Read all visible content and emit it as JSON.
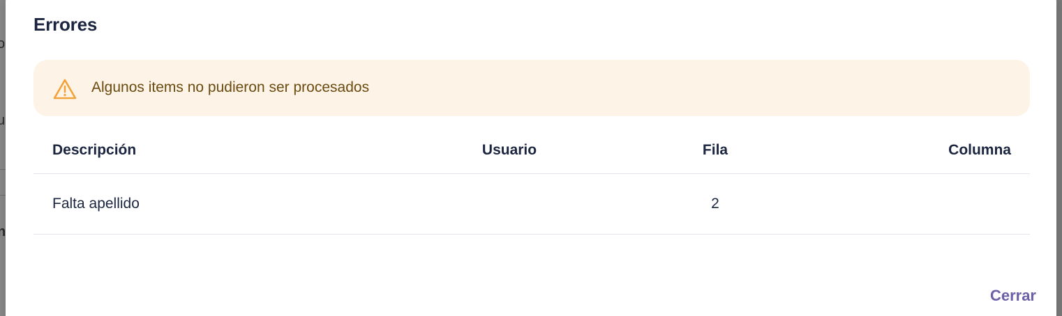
{
  "background": {
    "glyphs": [
      "o",
      "u",
      "n"
    ]
  },
  "modal": {
    "title": "Errores",
    "alert": {
      "icon": "warning-triangle-icon",
      "text": "Algunos items no pudieron ser procesados",
      "background_color": "#fdf4e7",
      "icon_color": "#f0a33a"
    },
    "table": {
      "headers": {
        "description": "Descripción",
        "user": "Usuario",
        "row": "Fila",
        "column": "Columna"
      },
      "rows": [
        {
          "description": "Falta apellido",
          "user": "",
          "row": "2",
          "column": ""
        }
      ]
    },
    "close_label": "Cerrar",
    "accent_color": "#6c5fa8"
  }
}
